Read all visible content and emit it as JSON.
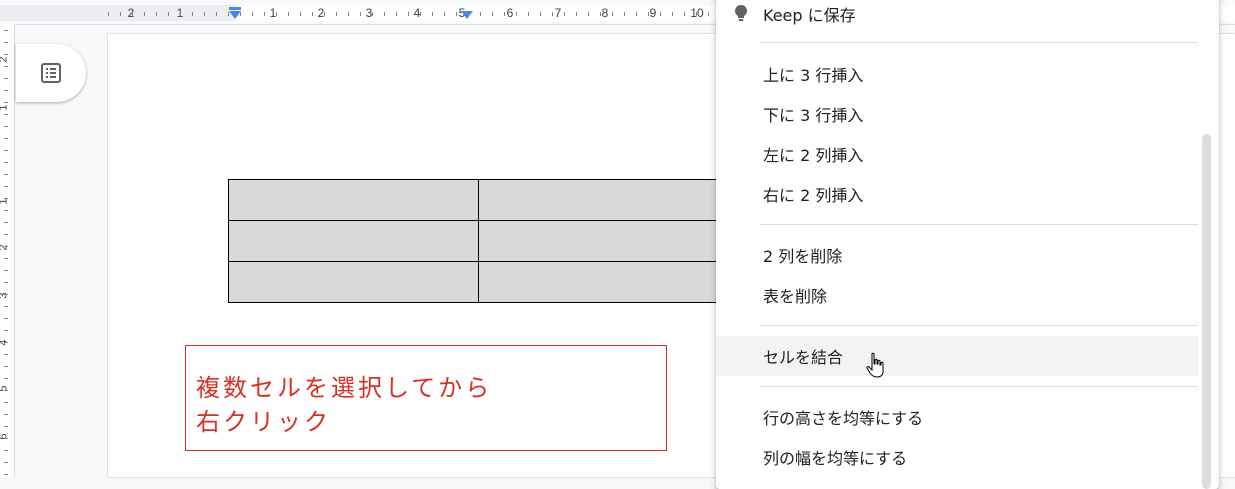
{
  "ruler": {
    "horizontal_numbers": [
      "2",
      "1",
      "1",
      "2",
      "3",
      "4",
      "5",
      "6",
      "7",
      "8",
      "9",
      "10"
    ],
    "vertical_numbers": [
      "2",
      "1",
      "1",
      "2",
      "3",
      "4",
      "5",
      "6"
    ]
  },
  "outline": {
    "icon": "document-outline-icon"
  },
  "table": {
    "rows": 3,
    "cols": 2,
    "fill_color": "#d9d9d9"
  },
  "annotation": {
    "line1": "複数セルを選択してから",
    "line2": "右クリック",
    "color": "#d93025"
  },
  "context_menu": {
    "keep": {
      "label": "Keep に保存",
      "icon": "keep-bulb-icon"
    },
    "insert_row_above": "上に 3 行挿入",
    "insert_row_below": "下に 3 行挿入",
    "insert_col_left": "左に 2 列挿入",
    "insert_col_right": "右に 2 列挿入",
    "delete_columns": "2 列を削除",
    "delete_table": "表を削除",
    "merge_cells": "セルを結合",
    "distribute_rows": "行の高さを均等にする",
    "distribute_cols": "列の幅を均等にする"
  }
}
